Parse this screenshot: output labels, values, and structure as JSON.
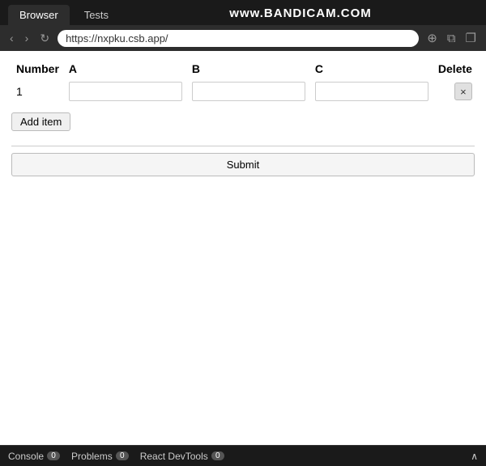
{
  "browser": {
    "tabs": [
      {
        "label": "Browser",
        "active": true
      },
      {
        "label": "Tests",
        "active": false
      }
    ],
    "watermark": "www.BANDICAM.COM",
    "address": "https://nxpku.csb.app/",
    "nav": {
      "back": "‹",
      "forward": "›",
      "refresh": "↻"
    },
    "action_icons": [
      "⊕",
      "⧉",
      "❐"
    ]
  },
  "page": {
    "table": {
      "columns": [
        "Number",
        "A",
        "B",
        "C",
        "Delete"
      ],
      "rows": [
        {
          "number": "1",
          "a_value": "",
          "b_value": "",
          "c_value": ""
        }
      ]
    },
    "add_item_label": "Add item",
    "submit_label": "Submit"
  },
  "bottom_bar": {
    "tabs": [
      {
        "label": "Console",
        "count": "0"
      },
      {
        "label": "Problems",
        "count": "0"
      },
      {
        "label": "React DevTools",
        "count": "0"
      }
    ],
    "arrow": "∧"
  }
}
